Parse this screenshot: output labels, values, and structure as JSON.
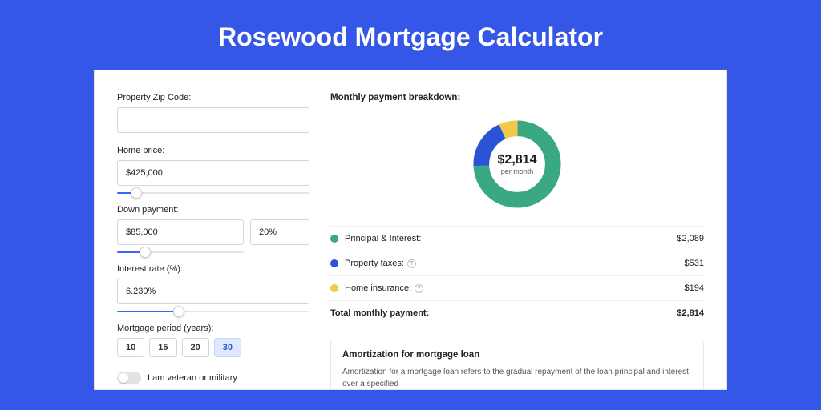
{
  "page": {
    "title": "Rosewood Mortgage Calculator"
  },
  "form": {
    "zip": {
      "label": "Property Zip Code:",
      "value": ""
    },
    "home_price": {
      "label": "Home price:",
      "value": "$425,000",
      "slider_pct": 10
    },
    "down_payment": {
      "label": "Down payment:",
      "value": "$85,000",
      "pct": "20%",
      "slider_pct": 22
    },
    "interest_rate": {
      "label": "Interest rate (%):",
      "value": "6.230%",
      "slider_pct": 32
    },
    "period": {
      "label": "Mortgage period (years):",
      "options": [
        "10",
        "15",
        "20",
        "30"
      ],
      "active": "30"
    },
    "veteran": {
      "label": "I am veteran or military",
      "on": false
    }
  },
  "breakdown": {
    "title": "Monthly payment breakdown:",
    "center_amount": "$2,814",
    "center_sub": "per month",
    "rows": {
      "pi": {
        "label": "Principal & Interest:",
        "value": "$2,089"
      },
      "pt": {
        "label": "Property taxes:",
        "value": "$531"
      },
      "hi": {
        "label": "Home insurance:",
        "value": "$194"
      }
    },
    "total": {
      "label": "Total monthly payment:",
      "value": "$2,814"
    }
  },
  "amort": {
    "title": "Amortization for mortgage loan",
    "text": "Amortization for a mortgage loan refers to the gradual repayment of the loan principal and interest over a specified"
  },
  "chart_data": {
    "type": "pie",
    "title": "Monthly payment breakdown",
    "series": [
      {
        "name": "Principal & Interest",
        "value": 2089,
        "color": "#3aa981"
      },
      {
        "name": "Property taxes",
        "value": 531,
        "color": "#2b53d8"
      },
      {
        "name": "Home insurance",
        "value": 194,
        "color": "#f3c84b"
      }
    ],
    "total": 2814
  }
}
